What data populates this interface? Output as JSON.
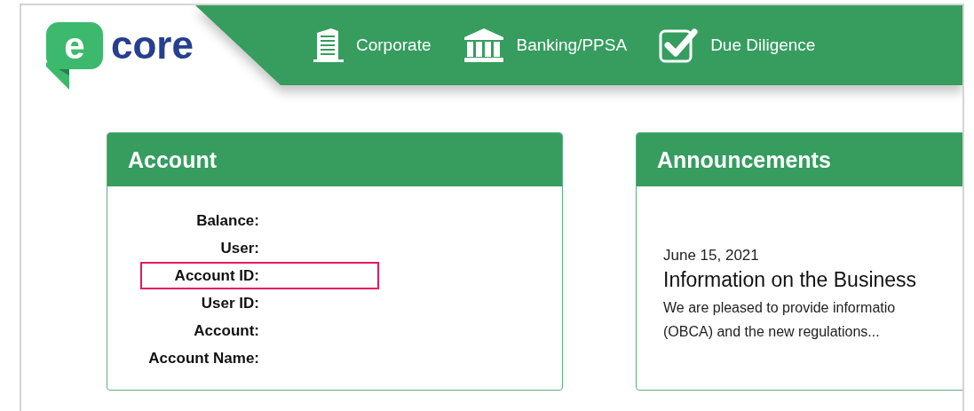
{
  "logo": {
    "mark": "e",
    "word": "core"
  },
  "nav": [
    {
      "label": "Corporate"
    },
    {
      "label": "Banking/PPSA"
    },
    {
      "label": "Due Diligence"
    }
  ],
  "account": {
    "title": "Account",
    "fields": [
      {
        "label": "Balance:",
        "highlighted": false
      },
      {
        "label": "User:",
        "highlighted": false
      },
      {
        "label": "Account ID:",
        "highlighted": true
      },
      {
        "label": "User ID:",
        "highlighted": false
      },
      {
        "label": "Account:",
        "highlighted": false
      },
      {
        "label": "Account Name:",
        "highlighted": false
      }
    ]
  },
  "announcements": {
    "title": "Announcements",
    "items": [
      {
        "date": "June 15, 2021",
        "title": "Information on the Business",
        "lines": [
          "We are pleased to provide informatio",
          "(OBCA) and the new regulations..."
        ]
      }
    ]
  }
}
